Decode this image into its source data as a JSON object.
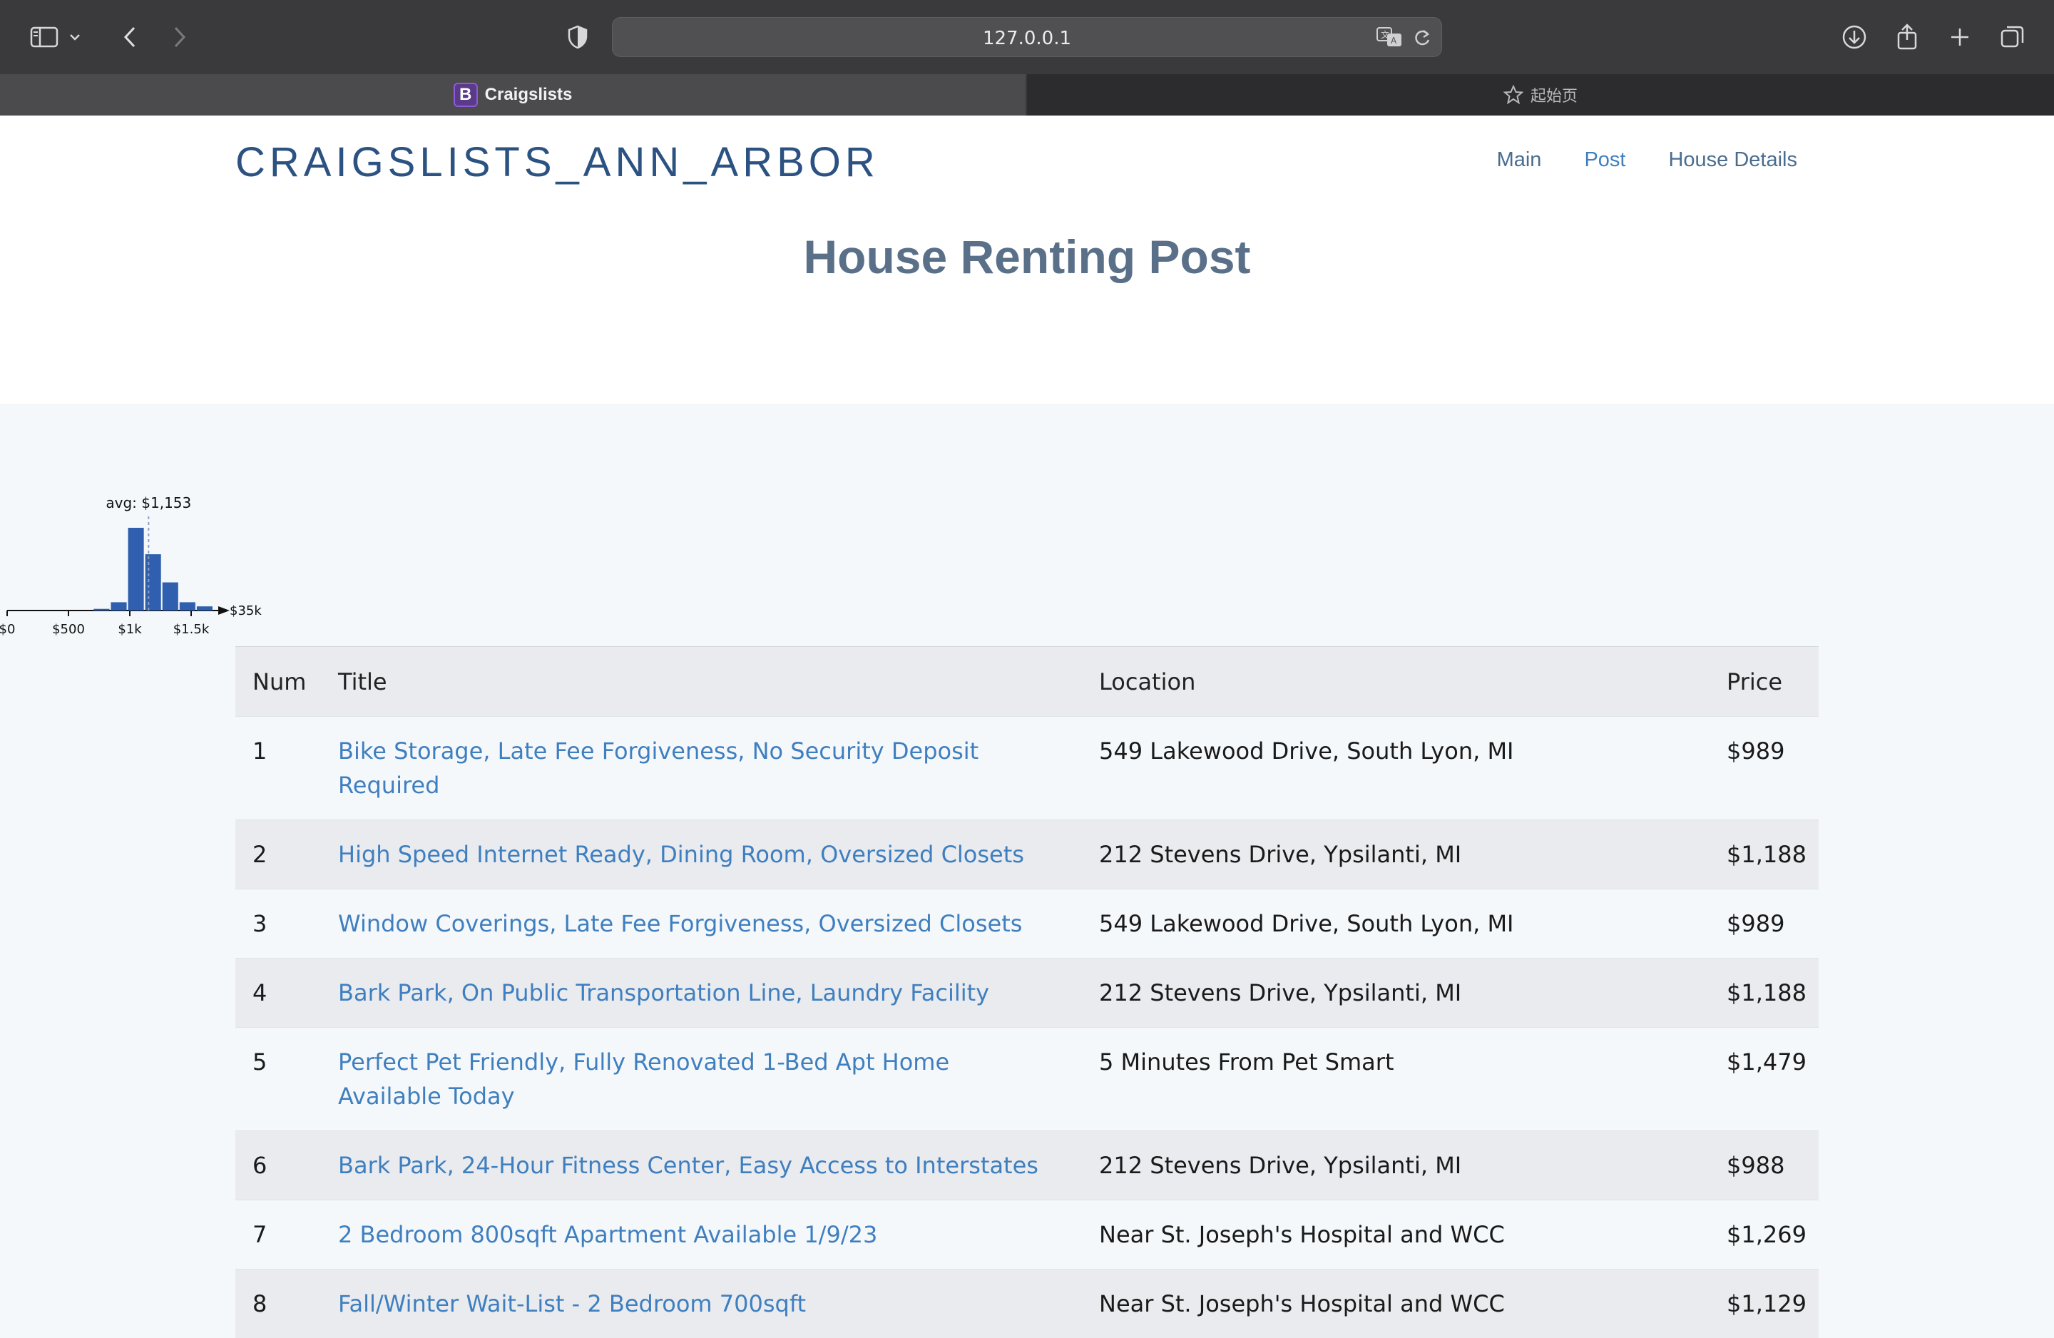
{
  "browser": {
    "url": "127.0.0.1",
    "active_tab": "Craigslists",
    "inactive_tab": "起始页",
    "favicon_letter": "B"
  },
  "site": {
    "brand": "CRAIGSLISTS_ANN_ARBOR",
    "nav": [
      "Main",
      "Post",
      "House Details"
    ],
    "active_nav": "Post",
    "page_title": "House Renting Post"
  },
  "chart_data": {
    "type": "bar",
    "annotation": "avg: $1,153",
    "avg": 1153,
    "x_tick_labels": [
      "$0",
      "$500",
      "$1k",
      "$1.5k"
    ],
    "x_tick_values": [
      0,
      500,
      1000,
      1500
    ],
    "axis_end_label": "$35k",
    "bin_width": 140,
    "bins": [
      {
        "start": 700,
        "height": 0.02
      },
      {
        "start": 840,
        "height": 0.1
      },
      {
        "start": 980,
        "height": 1.0
      },
      {
        "start": 1120,
        "height": 0.68
      },
      {
        "start": 1260,
        "height": 0.34
      },
      {
        "start": 1400,
        "height": 0.1
      },
      {
        "start": 1540,
        "height": 0.05
      }
    ],
    "bar_color": "#2f5fae"
  },
  "table": {
    "headers": [
      "Num",
      "Title",
      "Location",
      "Price"
    ],
    "rows": [
      {
        "num": "1",
        "title": "Bike Storage, Late Fee Forgiveness, No Security Deposit Required",
        "location": "549 Lakewood Drive, South Lyon, MI",
        "price": "$989"
      },
      {
        "num": "2",
        "title": "High Speed Internet Ready, Dining Room, Oversized Closets",
        "location": "212 Stevens Drive, Ypsilanti, MI",
        "price": "$1,188"
      },
      {
        "num": "3",
        "title": "Window Coverings, Late Fee Forgiveness, Oversized Closets",
        "location": "549 Lakewood Drive, South Lyon, MI",
        "price": "$989"
      },
      {
        "num": "4",
        "title": "Bark Park, On Public Transportation Line, Laundry Facility",
        "location": "212 Stevens Drive, Ypsilanti, MI",
        "price": "$1,188"
      },
      {
        "num": "5",
        "title": "Perfect Pet Friendly, Fully Renovated 1-Bed Apt Home Available Today",
        "location": "5 Minutes From Pet Smart",
        "price": "$1,479"
      },
      {
        "num": "6",
        "title": "Bark Park, 24-Hour Fitness Center, Easy Access to Interstates",
        "location": "212 Stevens Drive, Ypsilanti, MI",
        "price": "$988"
      },
      {
        "num": "7",
        "title": "2 Bedroom 800sqft Apartment Available 1/9/23",
        "location": "Near St. Joseph's Hospital and WCC",
        "price": "$1,269"
      },
      {
        "num": "8",
        "title": "Fall/Winter Wait-List - 2 Bedroom 700sqft",
        "location": "Near St. Joseph's Hospital and WCC",
        "price": "$1,129"
      }
    ]
  }
}
